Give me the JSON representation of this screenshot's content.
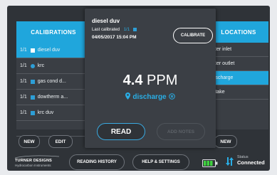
{
  "calibrations": {
    "header": "CALIBRATIONS",
    "items": [
      {
        "count": "1/1",
        "name": "diesel duv",
        "marker": "square",
        "selected": true
      },
      {
        "count": "1/1",
        "name": "krc",
        "marker": "circle",
        "selected": false
      },
      {
        "count": "1/1",
        "name": "gas cond d...",
        "marker": "square",
        "selected": false
      },
      {
        "count": "1/1",
        "name": "dowtherm a...",
        "marker": "square",
        "selected": false
      },
      {
        "count": "1/1",
        "name": "krc duv",
        "marker": "square",
        "selected": false
      }
    ],
    "new_label": "NEW",
    "edit_label": "EDIT"
  },
  "current": {
    "name": "diesel duv",
    "last_calibrated_label": "Last calibrated",
    "last_calibrated_count": "1/1",
    "date": "04/05/2017 15:04 PM",
    "calibrate_label": "CALIBRATE",
    "value": "4.4",
    "unit": "PPM",
    "location": "discharge",
    "read_label": "READ",
    "add_notes_label": "ADD NOTES"
  },
  "locations": {
    "header": "LOCATIONS",
    "items": [
      {
        "name": "filter inlet",
        "selected": false
      },
      {
        "name": "filter outlet",
        "selected": false
      },
      {
        "name": "discharge",
        "selected": true
      },
      {
        "name": "intake",
        "selected": false
      }
    ],
    "new_label": "NEW"
  },
  "footer": {
    "logo_line1": "TURNER DESIGNS",
    "logo_line2": "Hydrocarbon Instruments",
    "reading_history_label": "READING HISTORY",
    "help_settings_label": "HELP & SETTINGS",
    "status_label": "Status",
    "status_value": "Connected"
  },
  "colors": {
    "accent": "#20a6dc",
    "background": "#2f3338",
    "battery": "#3fd13f"
  }
}
